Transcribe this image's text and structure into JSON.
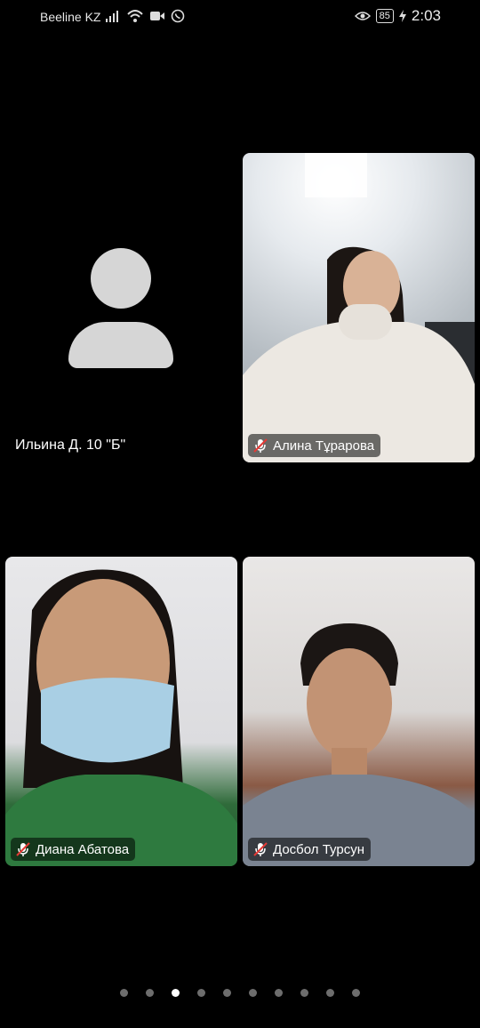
{
  "status_bar": {
    "carrier": "Beeline KZ",
    "battery": "85",
    "time": "2:03",
    "icons": [
      "signal-icon",
      "wifi-icon",
      "video-icon",
      "whatsapp-icon",
      "eye-icon",
      "charging-icon"
    ]
  },
  "self_tile": {
    "name": "Ильина Д. 10 \"Б\""
  },
  "participants": [
    {
      "name": "Алина Тұрарова",
      "muted": true
    },
    {
      "name": "Диана Абатова",
      "muted": true
    },
    {
      "name": "Досбол Турсун",
      "muted": true
    }
  ],
  "pager": {
    "count": 10,
    "active_index": 2
  }
}
